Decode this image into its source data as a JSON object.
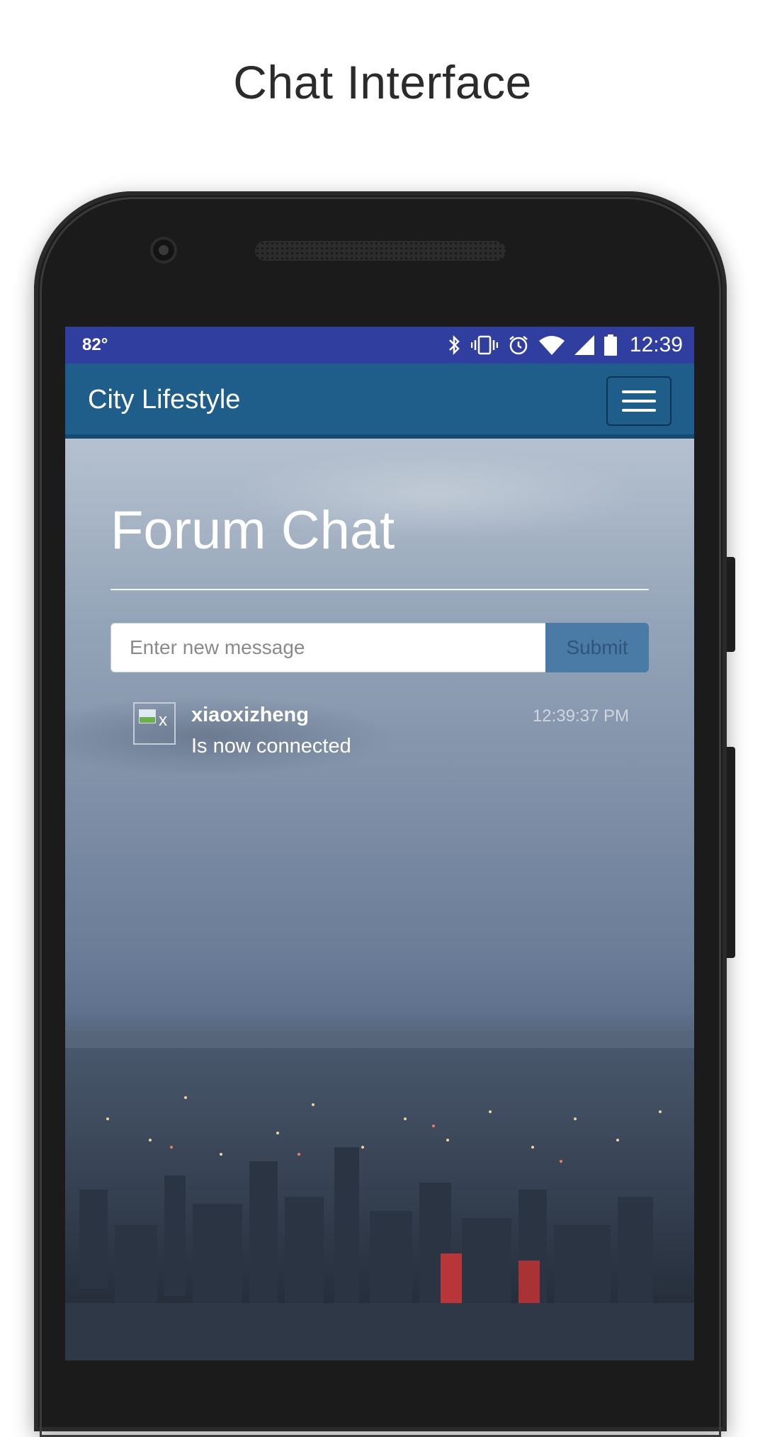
{
  "header": {
    "page_title": "Chat Interface"
  },
  "status_bar": {
    "temperature": "82°",
    "time": "12:39",
    "icons": [
      "bluetooth-icon",
      "vibrate-icon",
      "alarm-icon",
      "wifi-icon",
      "signal-icon",
      "battery-icon"
    ]
  },
  "app_bar": {
    "title": "City Lifestyle",
    "menu_icon": "hamburger-menu-icon"
  },
  "forum": {
    "title": "Forum Chat",
    "input_placeholder": "Enter new message",
    "submit_label": "Submit"
  },
  "messages": [
    {
      "user": "xiaoxizheng",
      "avatar_alt": "x",
      "text": "Is now connected",
      "time": "12:39:37 PM"
    }
  ],
  "colors": {
    "status_bar": "#303f9f",
    "app_bar": "#1f5d8a",
    "submit_button": "#4a7aa6"
  }
}
